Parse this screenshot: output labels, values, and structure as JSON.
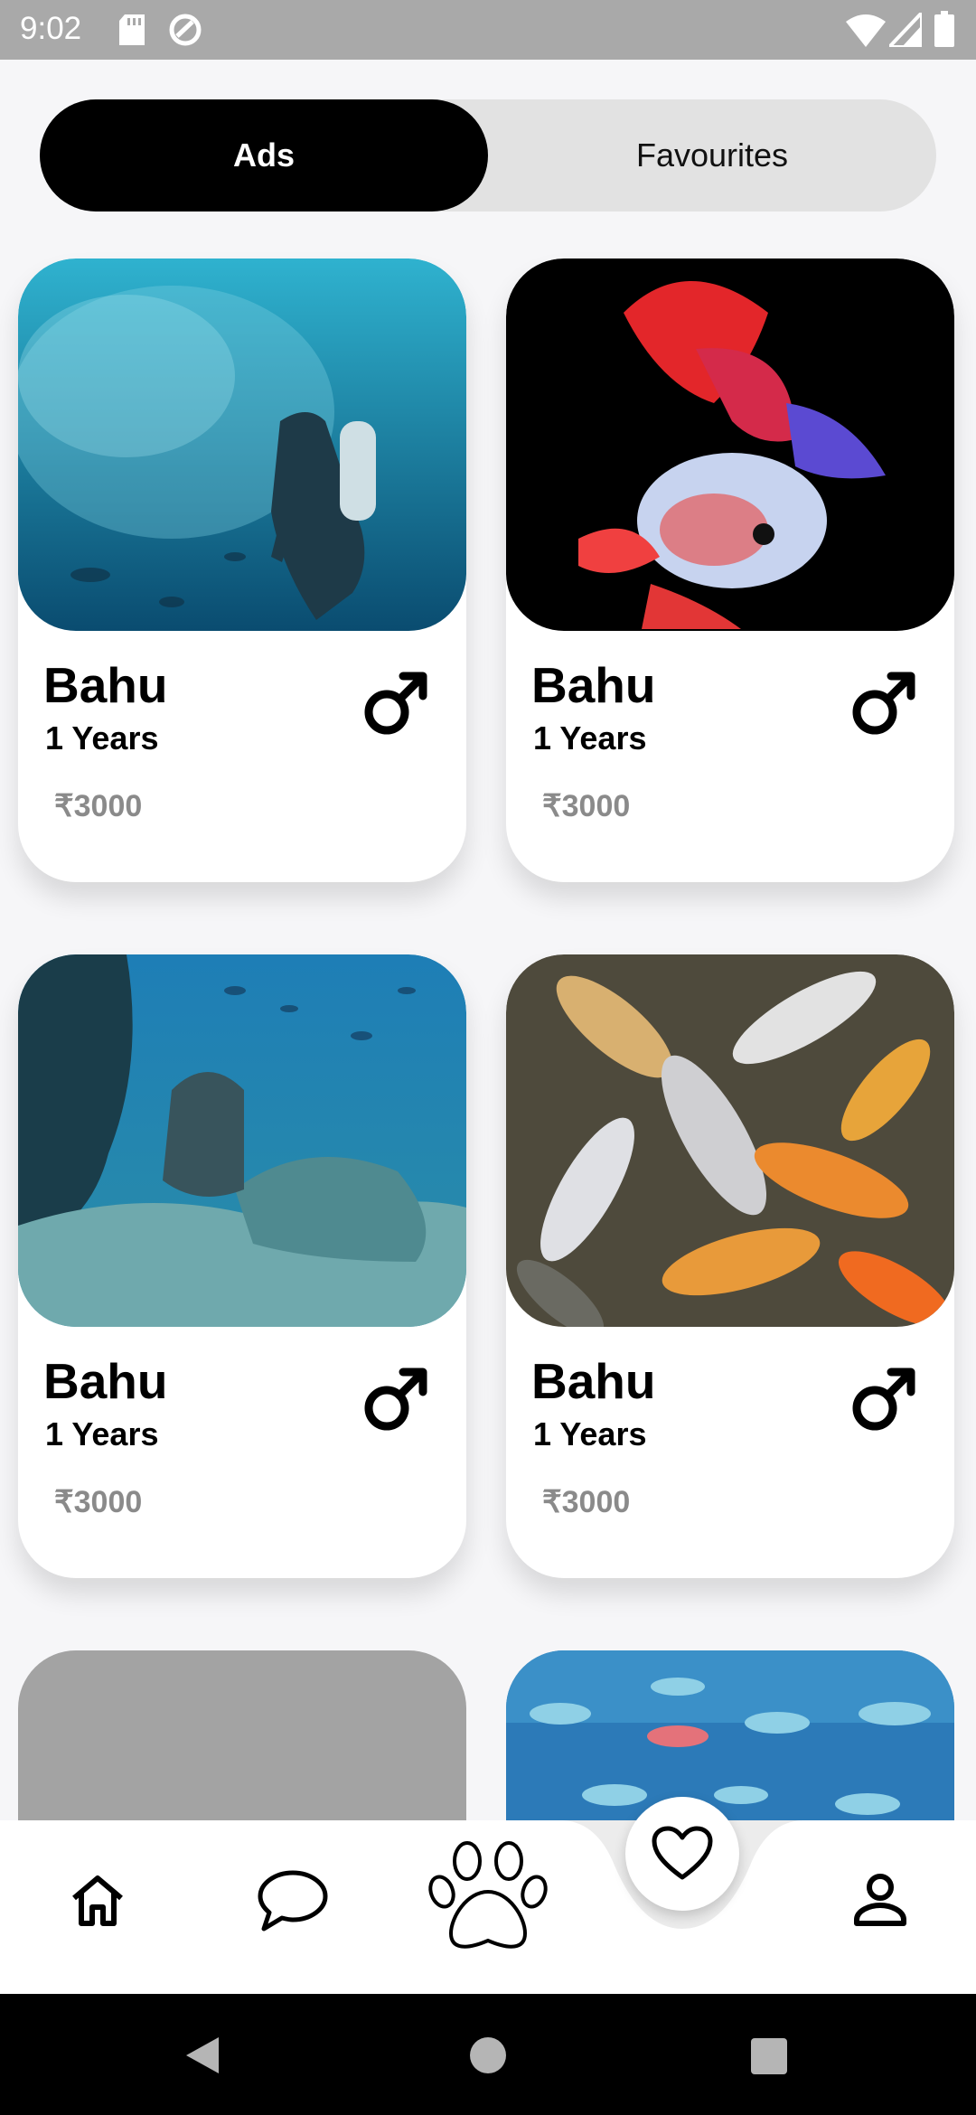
{
  "status_bar": {
    "time": "9:02",
    "icons": [
      "sd-card-icon",
      "sync-icon",
      "wifi-icon",
      "signal-icon",
      "battery-icon"
    ]
  },
  "tabs": {
    "ads_label": "Ads",
    "favourites_label": "Favourites",
    "selected": "Ads"
  },
  "cards": [
    {
      "name": "Bahu",
      "age": "1 Years",
      "price": "₹3000",
      "gender_icon": "male-icon",
      "image": "diver-with-fish-school"
    },
    {
      "name": "Bahu",
      "age": "1 Years",
      "price": "₹3000",
      "gender_icon": "male-icon",
      "image": "betta-fish"
    },
    {
      "name": "Bahu",
      "age": "1 Years",
      "price": "₹3000",
      "gender_icon": "male-icon",
      "image": "diver-on-reef"
    },
    {
      "name": "Bahu",
      "age": "1 Years",
      "price": "₹3000",
      "gender_icon": "male-icon",
      "image": "koi-fish"
    }
  ],
  "bottom_nav": {
    "items": [
      "home-icon",
      "chat-icon",
      "paw-icon",
      "heart-icon",
      "profile-icon"
    ],
    "active": "heart-icon"
  },
  "colors": {
    "tab_active_bg": "#000000",
    "tab_inactive_bg": "#e2e2e2",
    "price_text": "#8a8a8a",
    "status_bar_bg": "#a9a9a9",
    "system_nav_bg": "#000000"
  }
}
